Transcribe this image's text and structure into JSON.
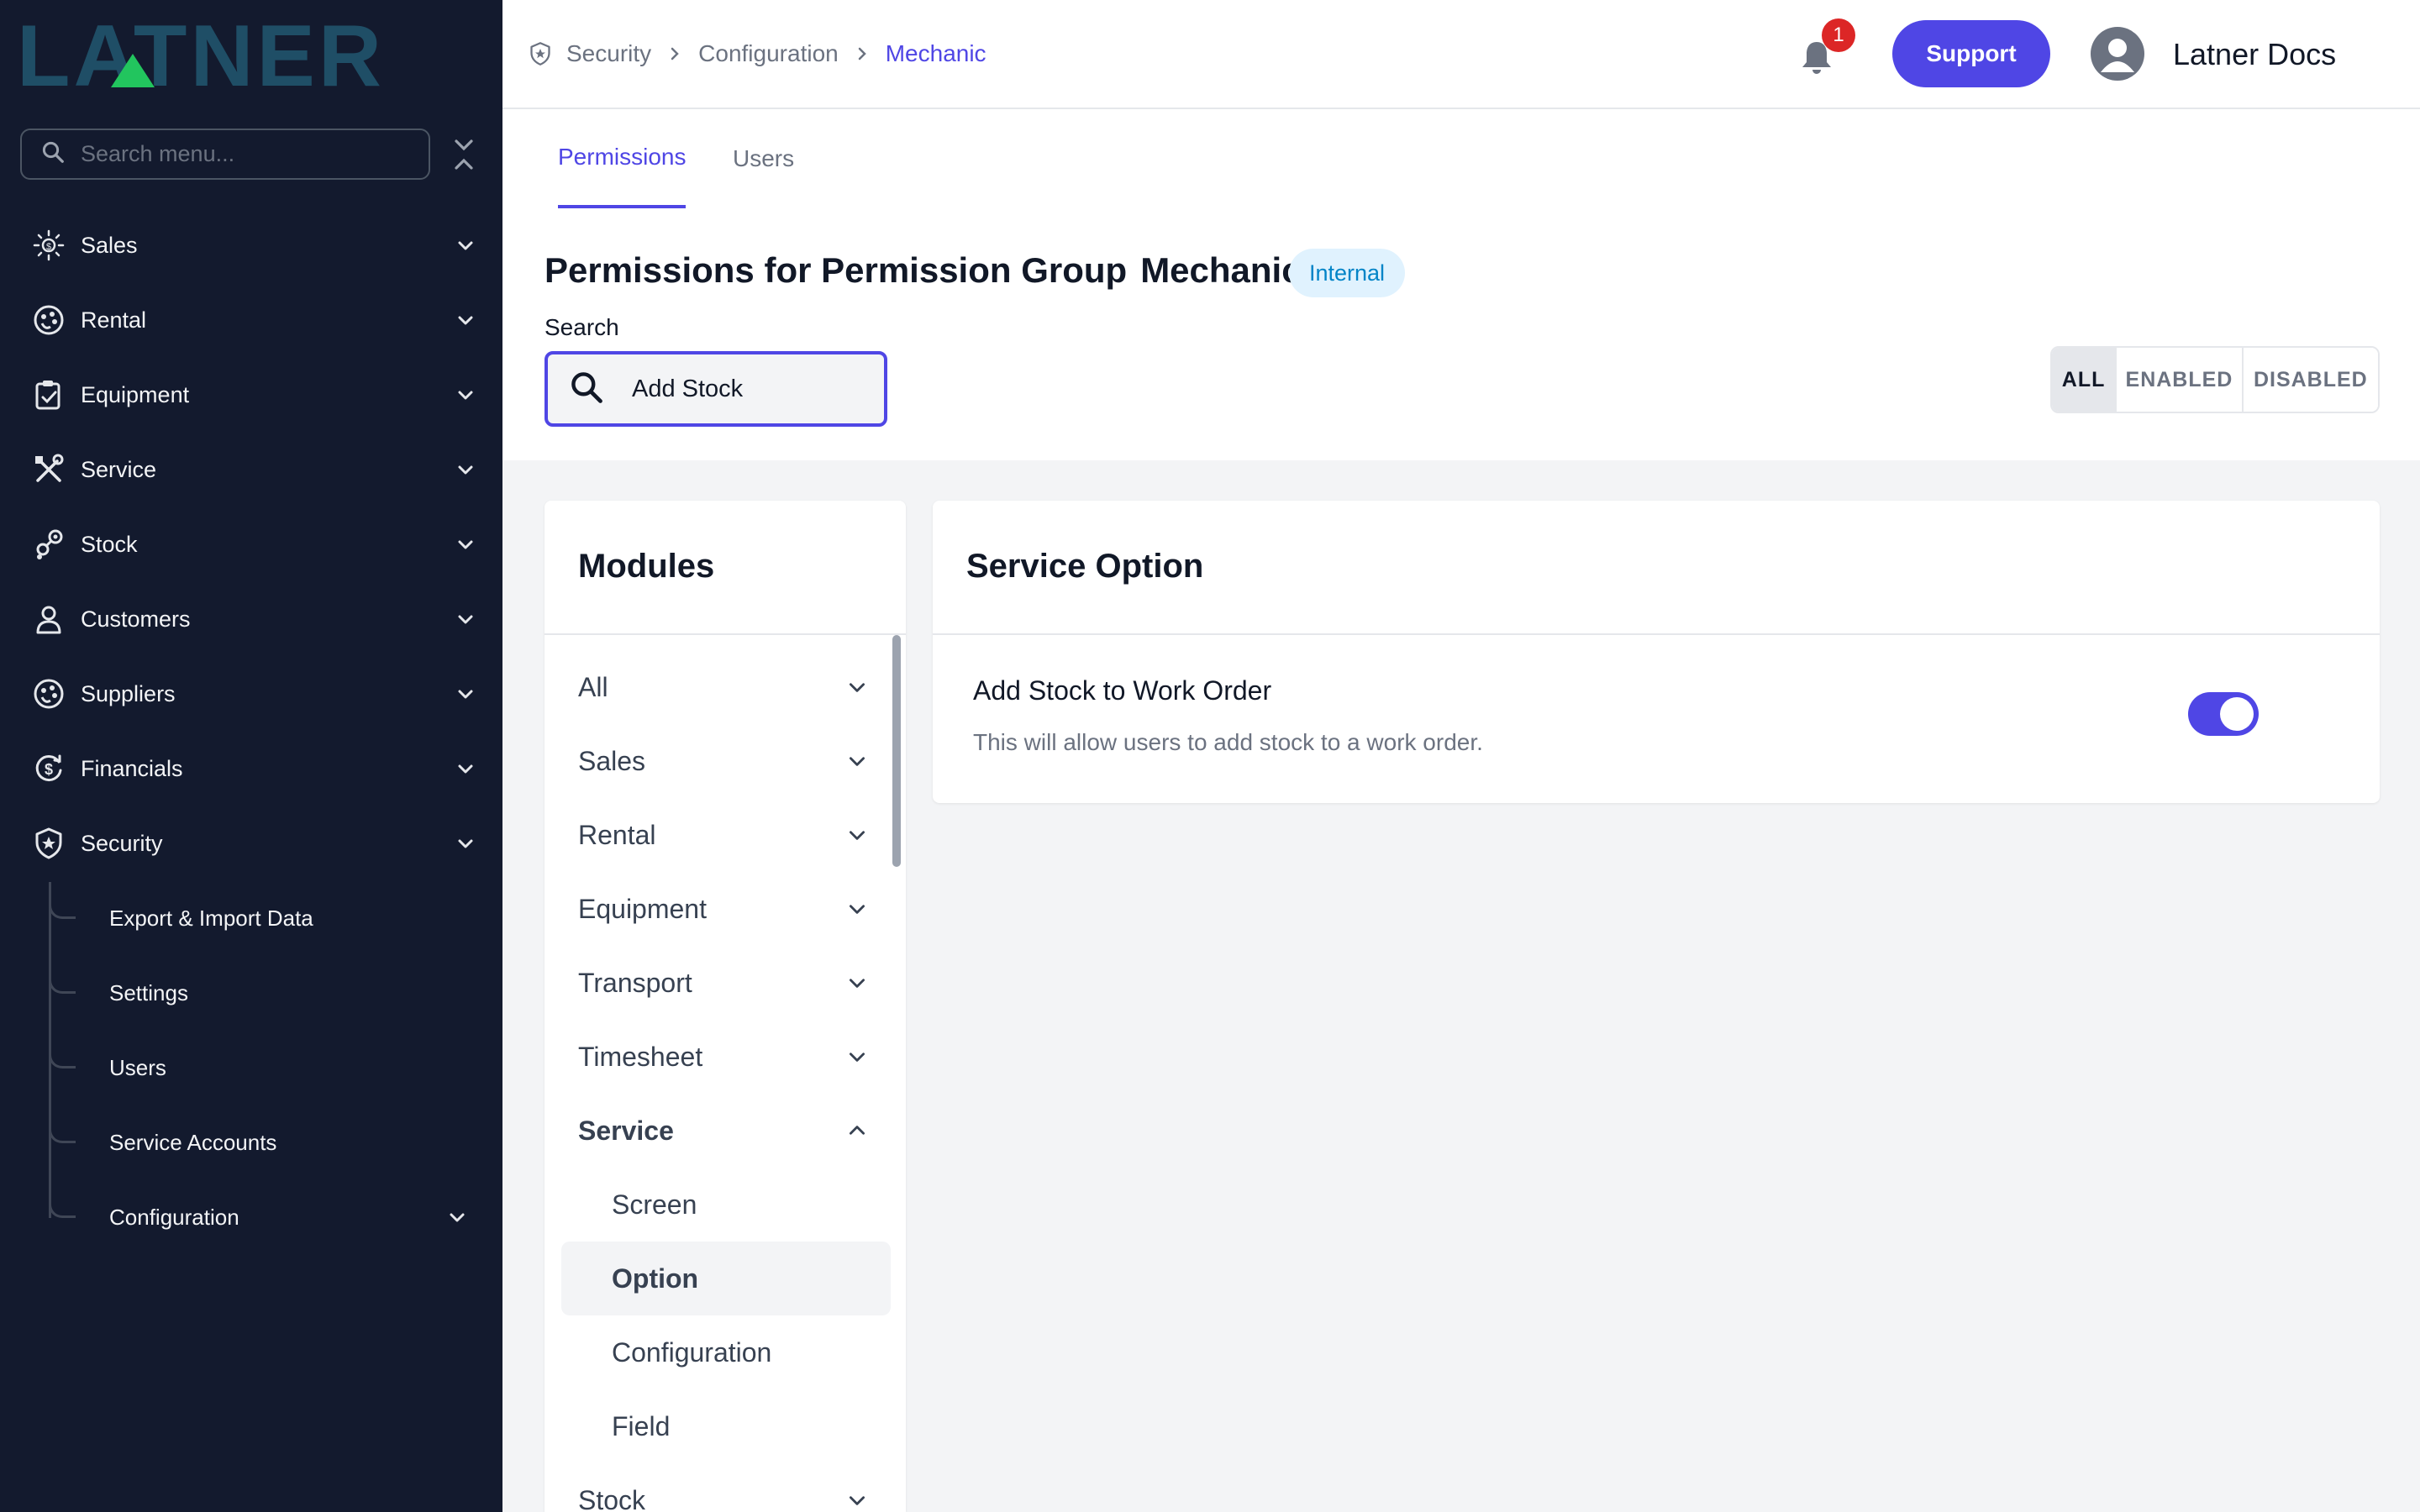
{
  "sidebar": {
    "search_placeholder": "Search menu...",
    "items": [
      {
        "label": "Sales",
        "icon": "sales-icon"
      },
      {
        "label": "Rental",
        "icon": "rental-icon"
      },
      {
        "label": "Equipment",
        "icon": "equipment-icon"
      },
      {
        "label": "Service",
        "icon": "service-icon"
      },
      {
        "label": "Stock",
        "icon": "stock-icon"
      },
      {
        "label": "Customers",
        "icon": "customers-icon"
      },
      {
        "label": "Suppliers",
        "icon": "suppliers-icon"
      },
      {
        "label": "Financials",
        "icon": "financials-icon"
      },
      {
        "label": "Security",
        "icon": "security-icon",
        "expanded": true
      }
    ],
    "security_children": [
      {
        "label": "Export & Import Data"
      },
      {
        "label": "Settings"
      },
      {
        "label": "Users"
      },
      {
        "label": "Service Accounts"
      },
      {
        "label": "Configuration"
      }
    ]
  },
  "header": {
    "breadcrumb": [
      "Security",
      "Configuration",
      "Mechanic"
    ],
    "notification_count": "1",
    "support_label": "Support",
    "user_name": "Latner Docs"
  },
  "tabs": [
    {
      "label": "Permissions",
      "active": true
    },
    {
      "label": "Users",
      "active": false
    }
  ],
  "permissions": {
    "title_prefix": "Permissions for Permission Group",
    "group_name": "Mechanic",
    "badge": "Internal",
    "search_label": "Search",
    "search_value": "Add Stock",
    "filters": [
      {
        "label": "ALL",
        "active": true
      },
      {
        "label": "ENABLED",
        "active": false
      },
      {
        "label": "DISABLED",
        "active": false
      }
    ]
  },
  "modules": {
    "title": "Modules",
    "items": [
      {
        "label": "All"
      },
      {
        "label": "Sales"
      },
      {
        "label": "Rental"
      },
      {
        "label": "Equipment"
      },
      {
        "label": "Transport"
      },
      {
        "label": "Timesheet"
      },
      {
        "label": "Service",
        "expanded": true
      },
      {
        "label": "Stock"
      }
    ],
    "service_children": [
      {
        "label": "Screen"
      },
      {
        "label": "Option",
        "active": true
      },
      {
        "label": "Configuration"
      },
      {
        "label": "Field"
      }
    ]
  },
  "option_panel": {
    "title": "Service Option",
    "permission_name": "Add Stock to Work Order",
    "permission_description": "This will allow users to add stock to a work order.",
    "enabled": true
  },
  "colors": {
    "accent": "#4f46e5",
    "sidebar_bg": "#131a2e",
    "badge_bg": "#e0f2fe",
    "badge_text": "#0284c7",
    "notification": "#dc2626"
  }
}
